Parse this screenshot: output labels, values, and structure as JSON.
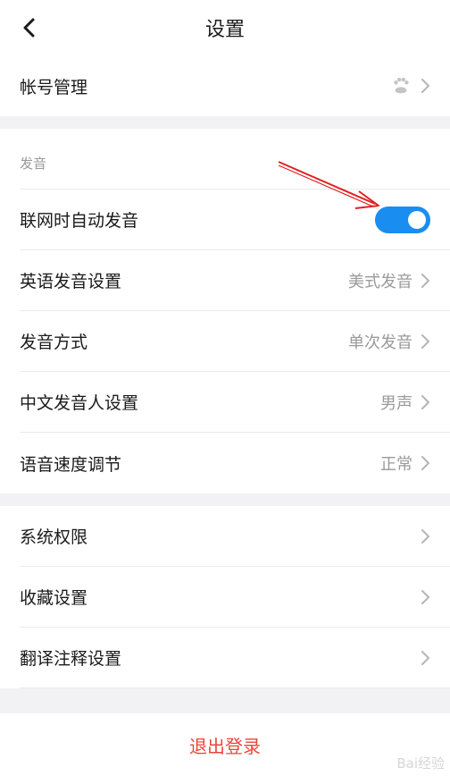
{
  "header": {
    "title": "设置"
  },
  "account": {
    "label": "帐号管理"
  },
  "pronunciation": {
    "section_label": "发音",
    "auto_play_label": "联网时自动发音",
    "auto_play_enabled": true,
    "rows": [
      {
        "label": "英语发音设置",
        "value": "美式发音"
      },
      {
        "label": "发音方式",
        "value": "单次发音"
      },
      {
        "label": "中文发音人设置",
        "value": "男声"
      },
      {
        "label": "语音速度调节",
        "value": "正常"
      }
    ]
  },
  "other": {
    "rows": [
      {
        "label": "系统权限"
      },
      {
        "label": "收藏设置"
      },
      {
        "label": "翻译注释设置"
      }
    ]
  },
  "logout": {
    "label": "退出登录"
  },
  "watermark": {
    "text": "Bai经验"
  },
  "colors": {
    "accent": "#1a8df0",
    "danger": "#e8463b",
    "annotation_arrow": "#e02020"
  },
  "icons": {
    "back": "back-arrow-icon",
    "account": "baidu-paw-icon",
    "chevron": "chevron-right-icon"
  }
}
